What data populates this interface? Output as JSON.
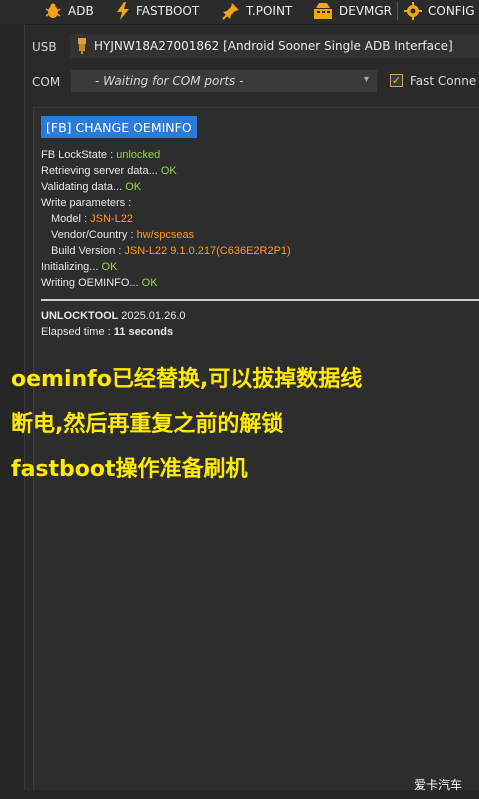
{
  "menu": {
    "items": [
      {
        "label": "ADB",
        "icon": "bug-icon"
      },
      {
        "label": "FASTBOOT",
        "icon": "lightning-icon"
      },
      {
        "label": "T.POINT",
        "icon": "pin-icon"
      },
      {
        "label": "DEVMGR",
        "icon": "devmgr-icon"
      },
      {
        "label": "CONFIG",
        "icon": "gear-icon"
      }
    ]
  },
  "usb": {
    "label": "USB",
    "device": "HYJNW18A27001862 [Android Sooner Single ADB Interface]"
  },
  "com": {
    "label": "COM",
    "selected": "- Waiting for COM ports -",
    "fast_connect_label": "Fast Conne",
    "fast_connect_checked": true
  },
  "log": {
    "header": "[FB] CHANGE OEMINFO",
    "lockstate_label": "FB LockState : ",
    "lockstate_value": "unlocked",
    "retrieving_label": "Retrieving server data... ",
    "retrieving_value": "OK",
    "validating_label": "Validating data... ",
    "validating_value": "OK",
    "write_params_label": "Write parameters :",
    "model_label": "Model : ",
    "model_value": "JSN-L22",
    "vendor_label": "Vendor/Country : ",
    "vendor_value": "hw/spcseas",
    "build_label": "Build Version : ",
    "build_value": "JSN-L22 9.1.0.217(C636E2R2P1)",
    "initializing_label": "Initializing... ",
    "initializing_value": "OK",
    "writing_label": "Writing OEMINFO... ",
    "writing_value": "OK",
    "tool_name": "UNLOCKTOOL ",
    "tool_version": "2025.01.26.0",
    "elapsed_label": "Elapsed time : ",
    "elapsed_value": "11 seconds"
  },
  "caption": {
    "line1": "oeminfo已经替换,可以拔掉数据线",
    "line2": "断电,然后再重复之前的解锁",
    "line3": "fastboot操作准备刷机"
  },
  "watermark": "爱卡汽车",
  "colors": {
    "ok": "#8fd94a",
    "highlight": "#ff9e1b",
    "header_bg": "#2b7cd9",
    "caption": "#ffea00"
  }
}
